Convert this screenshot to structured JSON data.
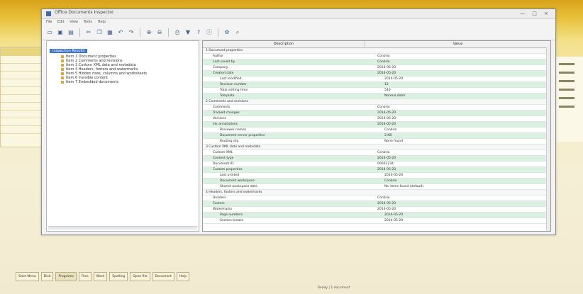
{
  "window": {
    "title": "Office Documents Inspector",
    "menu": [
      "File",
      "Edit",
      "View",
      "Tools",
      "Help"
    ],
    "controls": "— □ ×"
  },
  "toolbar": {
    "icons": [
      "new-icon",
      "open-icon",
      "save-icon",
      "sep",
      "cut-icon",
      "copy-icon",
      "paste-icon",
      "undo-icon",
      "redo-icon",
      "sep",
      "zoom-in-icon",
      "zoom-out-icon",
      "sep",
      "print-icon",
      "filter-icon",
      "help-icon",
      "info-icon",
      "sep",
      "settings-icon",
      "search-icon"
    ]
  },
  "tree": {
    "root_label": "Inspection Results",
    "items": [
      "Item 1  Document properties",
      "Item 2  Comments and revisions",
      "Item 3  Custom XML data and metadata",
      "Item 4  Headers, footers and watermarks",
      "Item 5  Hidden rows, columns and worksheets",
      "Item 6  Invisible content",
      "Item 7  Embedded documents"
    ]
  },
  "table": {
    "col_name": "Description",
    "col_value": "Value",
    "rows": [
      {
        "level": "group",
        "k": "1  Document properties",
        "v": ""
      },
      {
        "level": "sub",
        "k": "Author",
        "v": "Conbrio"
      },
      {
        "level": "sub",
        "k": "Last saved by",
        "v": "Conbrio"
      },
      {
        "level": "sub",
        "k": "Company",
        "v": "2014-05-20"
      },
      {
        "level": "sub",
        "k": "Created date",
        "v": "2014-05-20"
      },
      {
        "level": "sub2",
        "k": "Last modified",
        "v": "2014-05-20"
      },
      {
        "level": "sub2",
        "k": "Revision number",
        "v": "12"
      },
      {
        "level": "sub2",
        "k": "Total editing time",
        "v": "540"
      },
      {
        "level": "sub2",
        "k": "Template",
        "v": "Normal.dotm"
      },
      {
        "level": "group",
        "k": "2  Comments and revisions",
        "v": ""
      },
      {
        "level": "sub",
        "k": "Comments",
        "v": "Conbrio"
      },
      {
        "level": "sub",
        "k": "Tracked changes",
        "v": "2014-05-20"
      },
      {
        "level": "sub",
        "k": "Versions",
        "v": "2014-05-20"
      },
      {
        "level": "sub",
        "k": "Ink annotations",
        "v": "2014-05-20"
      },
      {
        "level": "sub2",
        "k": "Reviewer names",
        "v": "Conbrio"
      },
      {
        "level": "sub2",
        "k": "Document server properties",
        "v": "2 KB"
      },
      {
        "level": "sub2",
        "k": "Routing slip",
        "v": "None found"
      },
      {
        "level": "group",
        "k": "3  Custom XML data and metadata",
        "v": ""
      },
      {
        "level": "sub",
        "k": "Custom XML",
        "v": "Conbrio"
      },
      {
        "level": "sub",
        "k": "Content type",
        "v": "2014-05-20"
      },
      {
        "level": "sub",
        "k": "Document ID",
        "v": "00001234"
      },
      {
        "level": "sub",
        "k": "Custom properties",
        "v": "2014-05-20"
      },
      {
        "level": "sub2",
        "k": "Last printed",
        "v": "2014-05-20"
      },
      {
        "level": "sub2",
        "k": "Document workspace",
        "v": "Conbrio"
      },
      {
        "level": "sub2",
        "k": "Shared workspace data",
        "v": "No items found (default)"
      },
      {
        "level": "group",
        "k": "4  Headers, footers and watermarks",
        "v": ""
      },
      {
        "level": "sub",
        "k": "Headers",
        "v": "Conbrio"
      },
      {
        "level": "sub",
        "k": "Footers",
        "v": "2014-05-20"
      },
      {
        "level": "sub",
        "k": "Watermarks",
        "v": "2014-05-20"
      },
      {
        "level": "sub2",
        "k": "Page numbers",
        "v": "2014-05-20"
      },
      {
        "level": "sub2",
        "k": "Section breaks",
        "v": "2014-05-20"
      }
    ]
  },
  "taskbar": {
    "items": [
      "Start Menu",
      "Disk",
      "Programs",
      "Files",
      "Word",
      "Spelling",
      "Open file",
      "Document",
      "Help"
    ]
  },
  "status": {
    "text": "Ready  |  1 document"
  }
}
